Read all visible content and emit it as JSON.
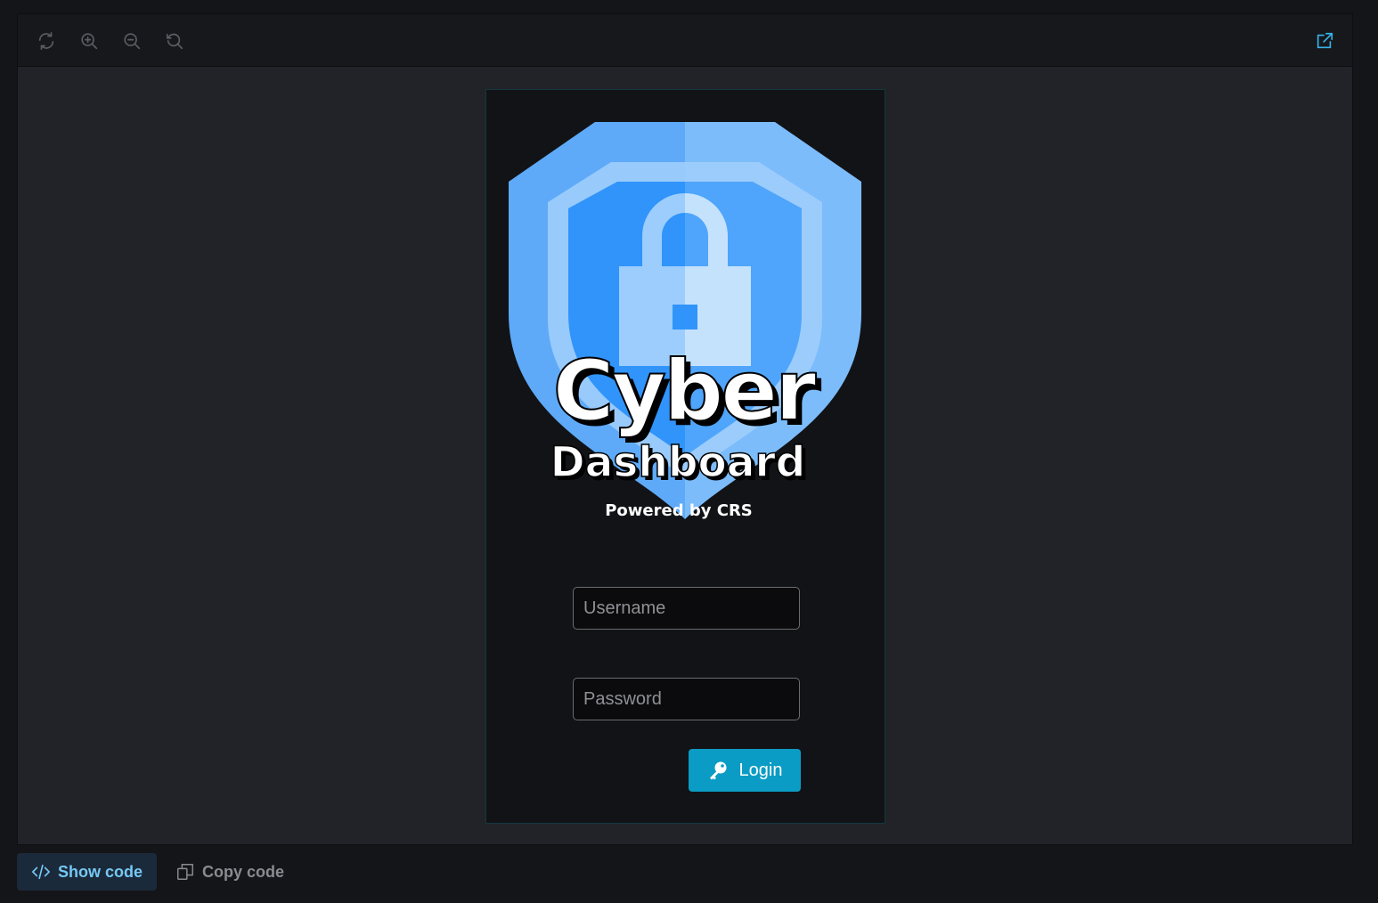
{
  "toolbar": {
    "icons": [
      "refresh-icon",
      "zoom-in-icon",
      "zoom-out-icon",
      "reset-zoom-icon",
      "open-external-icon"
    ],
    "icon_color": "#5c5e64",
    "accent_color": "#35b3ea"
  },
  "logo": {
    "title": "Cyber",
    "subtitle": "Dashboard",
    "tagline": "Powered by CRS",
    "colors": {
      "shield_outer_left": "#5eaaf9",
      "shield_outer_right": "#7cbcfb",
      "shield_ring": "#9ecdfc",
      "shield_inner_left": "#3094fb",
      "shield_inner_right": "#4fa5fb",
      "lock_left": "#9ccdfd",
      "lock_right": "#c5e2fd"
    }
  },
  "form": {
    "username_placeholder": "Username",
    "password_placeholder": "Password",
    "login_label": "Login",
    "login_color": "#0a9cc5"
  },
  "bottom": {
    "show_code_label": "Show code",
    "copy_code_label": "Copy code"
  }
}
